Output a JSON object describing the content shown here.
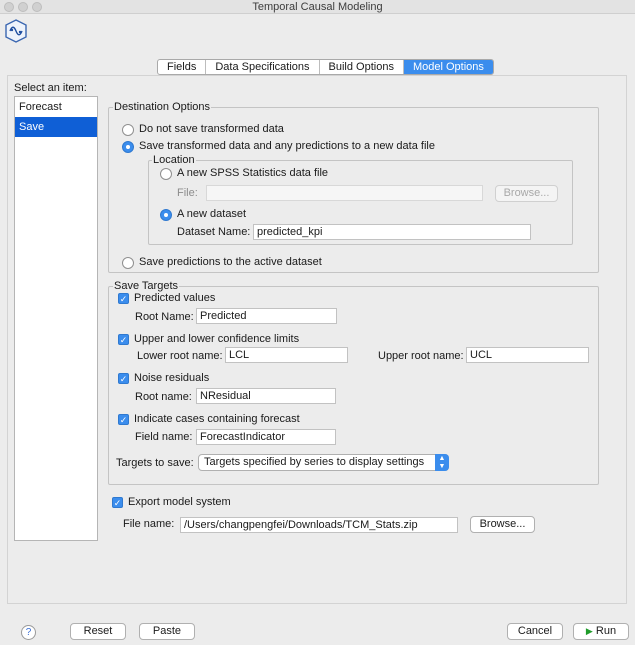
{
  "window": {
    "title": "Temporal Causal Modeling"
  },
  "tabs": [
    {
      "label": "Fields"
    },
    {
      "label": "Data Specifications"
    },
    {
      "label": "Build Options"
    },
    {
      "label": "Model Options",
      "active": true
    }
  ],
  "sidebar": {
    "label": "Select an item:",
    "items": [
      {
        "label": "Forecast"
      },
      {
        "label": "Save",
        "selected": true
      }
    ]
  },
  "destination": {
    "legend": "Destination Options",
    "opt_no_save": "Do not save transformed data",
    "opt_new_file": "Save transformed data and any predictions to a new data file",
    "location_legend": "Location",
    "opt_spss_file": "A new SPSS Statistics data file",
    "file_label": "File:",
    "file_value": "",
    "browse_label": "Browse...",
    "opt_new_dataset": "A new dataset",
    "dataset_name_label": "Dataset Name:",
    "dataset_name_value": "predicted_kpi",
    "opt_active": "Save predictions to the active dataset"
  },
  "targets": {
    "legend": "Save Targets",
    "predicted_label": "Predicted values",
    "predicted_root_label": "Root Name:",
    "predicted_root_value": "Predicted",
    "limits_label": "Upper and lower confidence limits",
    "lower_root_label": "Lower root name:",
    "lower_root_value": "LCL",
    "upper_root_label": "Upper root name:",
    "upper_root_value": "UCL",
    "noise_label": "Noise residuals",
    "noise_root_label": "Root name:",
    "noise_root_value": "NResidual",
    "indicate_label": "Indicate cases containing forecast",
    "field_name_label": "Field name:",
    "field_name_value": "ForecastIndicator",
    "targets_to_save_label": "Targets to save:",
    "targets_to_save_value": "Targets specified by series to display settings"
  },
  "export": {
    "checkbox_label": "Export model system",
    "file_name_label": "File name:",
    "file_name_value": "/Users/changpengfei/Downloads/TCM_Stats.zip",
    "browse_label": "Browse..."
  },
  "footer": {
    "help": "?",
    "reset": "Reset",
    "paste": "Paste",
    "cancel": "Cancel",
    "run": "Run"
  },
  "colors": {
    "accent": "#3b8ded",
    "selection": "#0f5fd6"
  }
}
